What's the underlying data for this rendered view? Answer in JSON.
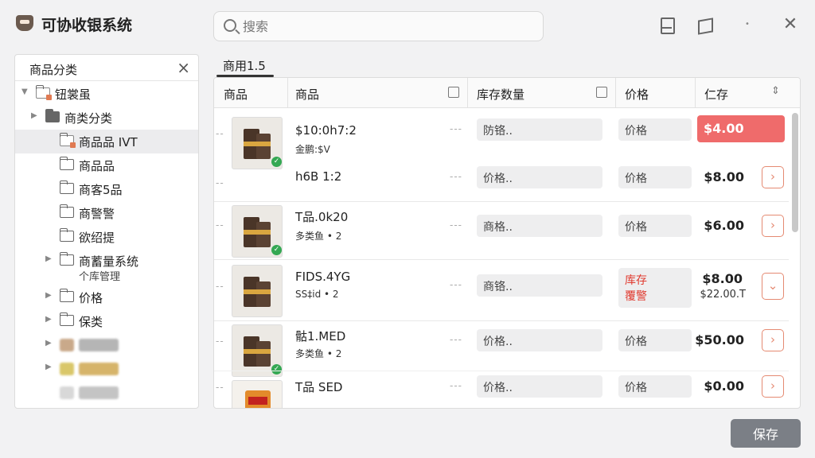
{
  "app": {
    "title": "可协收银系统"
  },
  "search": {
    "placeholder": "搜索"
  },
  "sidebar": {
    "title": "商品分类",
    "items": [
      {
        "label": "钮裳虽"
      },
      {
        "label": "商类分类"
      },
      {
        "label": "商品品 IVT"
      },
      {
        "label": "商品品"
      },
      {
        "label": "商客5品"
      },
      {
        "label": "商警警"
      },
      {
        "label": "欲绍提"
      },
      {
        "label": "商蓄量系统",
        "sub": "个库管理"
      },
      {
        "label": "价格"
      },
      {
        "label": "保类"
      }
    ]
  },
  "main": {
    "tab": "商用1.5",
    "headers": [
      "商品",
      "商品",
      "库存数量",
      "价格",
      "仁存"
    ],
    "rows": [
      {
        "name": "$10:0h7:2",
        "sub": "金鹏:$V",
        "stock": "防铬..",
        "price_field": "价格",
        "price": "$4.00"
      },
      {
        "name": "h6B 1:2",
        "sub": "",
        "stock": "价格..",
        "price_field": "价格",
        "price": "$8.00"
      },
      {
        "name": "T品.0k20",
        "sub": "多类鱼 • 2",
        "stock": "商格..",
        "price_field": "价格",
        "price": "$6.00"
      },
      {
        "name": "FIDS.4YG",
        "sub": "SS‡id • 2",
        "stock": "商铬..",
        "warn_1": "库存",
        "warn_2": "覆警",
        "price": "$8.00",
        "price_sub": "$22.00.T"
      },
      {
        "name": "骷1.MED",
        "sub": "多类鱼 • 2",
        "stock": "价格..",
        "price_field": "价格",
        "price": "$50.00"
      },
      {
        "name": "T品 SED",
        "sub": "",
        "stock": "价格..",
        "price_field": "价格",
        "price": "$0.00"
      }
    ]
  },
  "footer": {
    "save_label": "保存"
  },
  "colors": {
    "accent_red": "#ef6b6b",
    "warn_text": "#e03a2f",
    "save_button": "#7b7f86",
    "check_green": "#34a853"
  }
}
